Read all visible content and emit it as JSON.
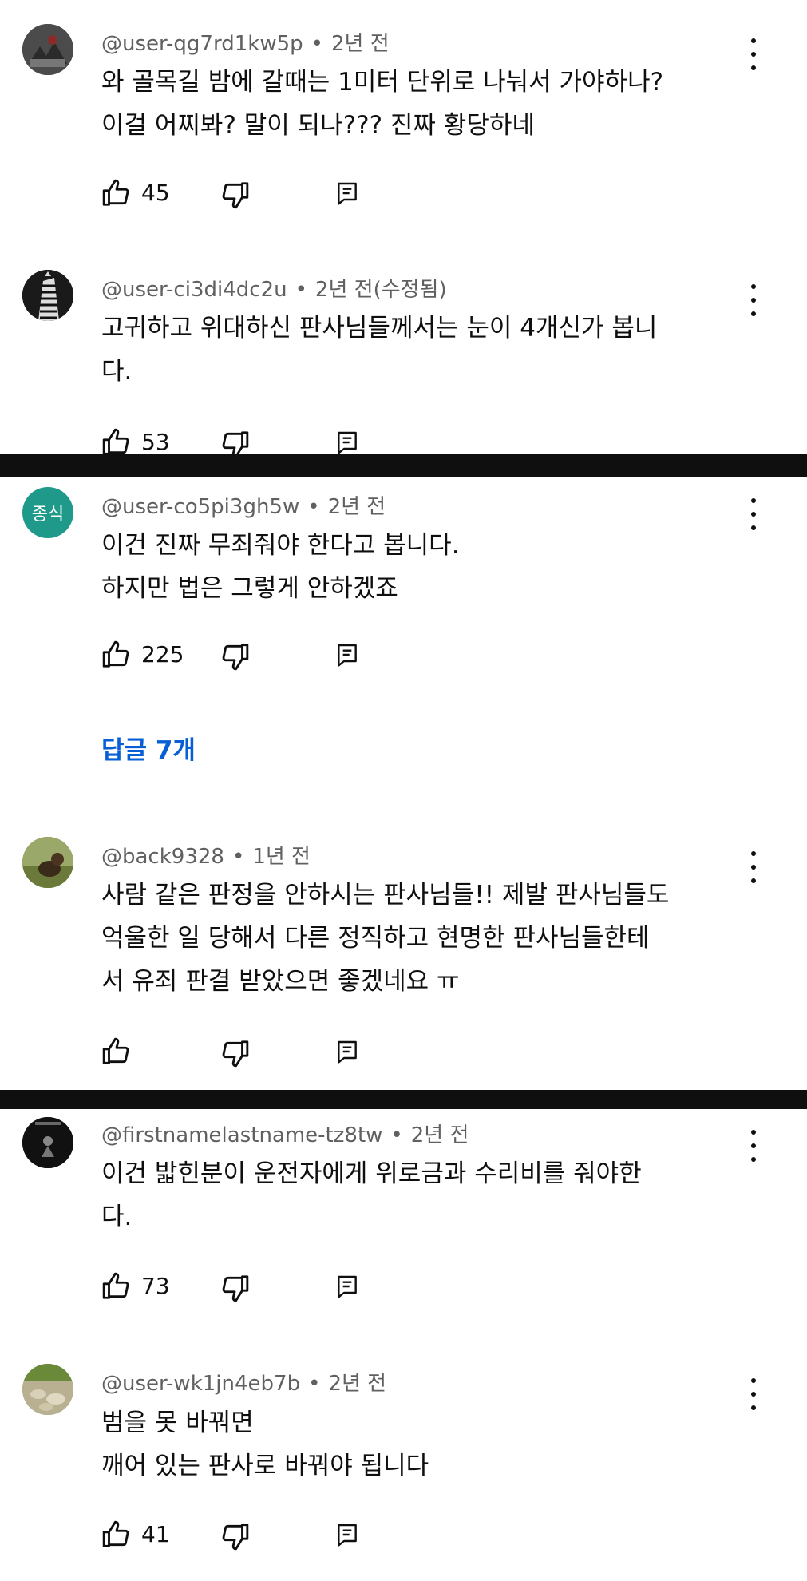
{
  "comments": [
    {
      "author": "@user-qg7rd1kw5p",
      "time": "2년 전",
      "edited": "",
      "lines": [
        "와 골목길 밤에 갈때는 1미터 단위로 나눠서 가야하나?",
        "이걸 어찌봐? 말이 되나??? 진짜 황당하네"
      ],
      "likes": "45",
      "avatar": "photo-dark"
    },
    {
      "author": "@user-ci3di4dc2u",
      "time": "2년 전",
      "edited": "(수정됨)",
      "lines": [
        "고귀하고 위대하신 판사님들께서는 눈이 4개신가 봅니",
        "다."
      ],
      "likes": "53",
      "avatar": "zebra"
    },
    {
      "author": "@user-co5pi3gh5w",
      "time": "2년 전",
      "edited": "",
      "lines": [
        "이건 진짜 무죄줘야 한다고 봅니다.",
        "하지만 법은 그렇게 안하겠죠"
      ],
      "likes": "225",
      "avatar_text": "종식",
      "avatar_color": "#1f9a8a",
      "replies_label": "답글 7개"
    },
    {
      "author": "@back9328",
      "time": "1년 전",
      "edited": "",
      "lines": [
        "사람 같은 판정을 안하시는 판사님들!! 제발 판사님들도",
        "억울한 일 당해서 다른 정직하고 현명한 판사님들한테",
        "서 유죄 판결 받았으면 좋겠네요 ㅠ"
      ],
      "likes": "",
      "avatar": "dog"
    },
    {
      "author": "@firstnamelastname-tz8tw",
      "time": "2년 전",
      "edited": "",
      "lines": [
        "이건 밟힌분이 운전자에게 위로금과 수리비를 줘야한",
        "다."
      ],
      "likes": "73",
      "avatar": "dark-figure"
    },
    {
      "author": "@user-wk1jn4eb7b",
      "time": "2년 전",
      "edited": "",
      "lines": [
        "범을 못 바꿔면",
        "깨어 있는 판사로 바꿔야 됩니다"
      ],
      "likes": "41",
      "avatar": "stones"
    }
  ],
  "icons": {
    "like": "thumbs-up-icon",
    "dislike": "thumbs-down-icon",
    "reply": "reply-icon",
    "more": "more-vertical-icon"
  },
  "colors": {
    "link": "#065fd4",
    "meta": "#606060",
    "text": "#0f0f0f"
  }
}
